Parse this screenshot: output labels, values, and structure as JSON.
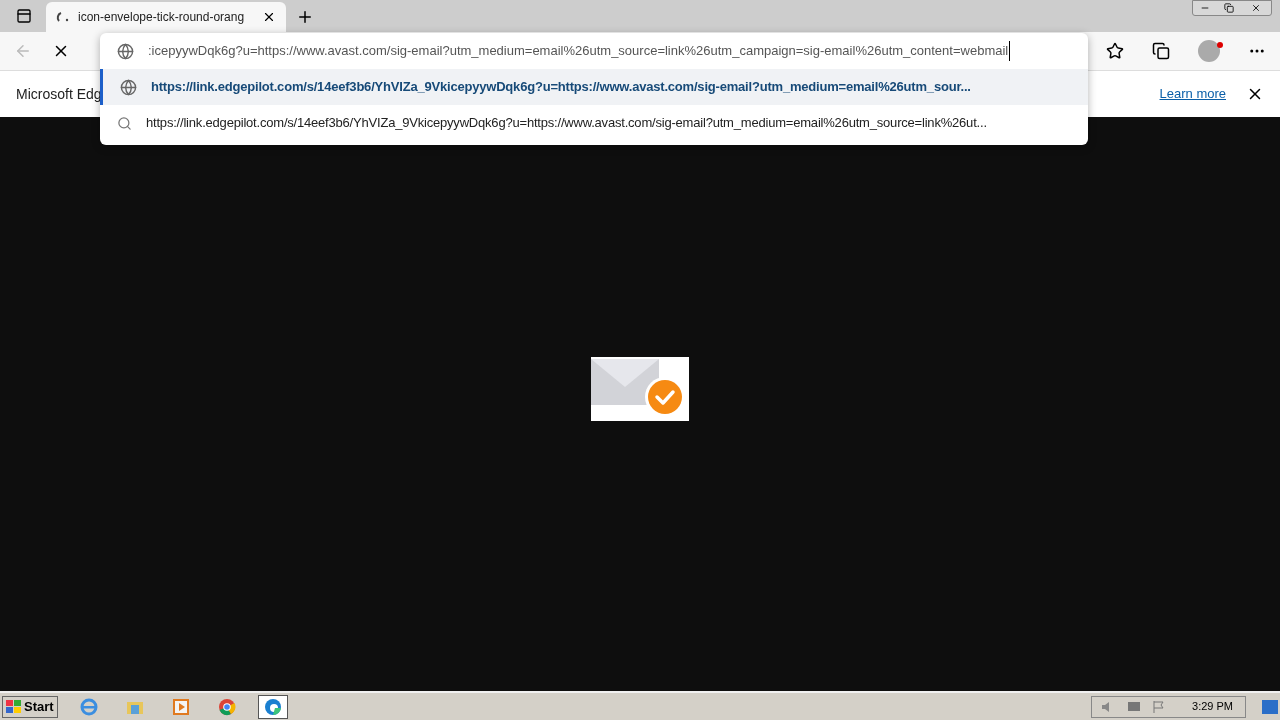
{
  "tab": {
    "title": "icon-envelope-tick-round-orang",
    "selected": true
  },
  "address": {
    "value": ":icepyywDqk6g?u=https://www.avast.com/sig-email?utm_medium=email%26utm_source=link%26utm_campaign=sig-email%26utm_content=webmail"
  },
  "suggestions": [
    {
      "kind": "url",
      "selected": true,
      "text": "https://link.edgepilot.com/s/14eef3b6/YhVIZa_9VkicepyywDqk6g?u=https://www.avast.com/sig-email?utm_medium=email%26utm_sour..."
    },
    {
      "kind": "search",
      "selected": false,
      "text": "https://link.edgepilot.com/s/14eef3b6/YhVIZa_9VkicepyywDqk6g?u=https://www.avast.com/sig-email?utm_medium=email%26utm_source=link%26ut..."
    }
  ],
  "infobar": {
    "text": "Microsoft Edg",
    "link": "Learn more"
  },
  "taskbar": {
    "start": "Start",
    "apps": [
      {
        "kind": "ie",
        "selected": false
      },
      {
        "kind": "folder",
        "selected": false
      },
      {
        "kind": "media",
        "selected": false
      },
      {
        "kind": "chrome",
        "selected": false
      },
      {
        "kind": "edge",
        "selected": true
      }
    ],
    "clock": "3:29 PM"
  }
}
